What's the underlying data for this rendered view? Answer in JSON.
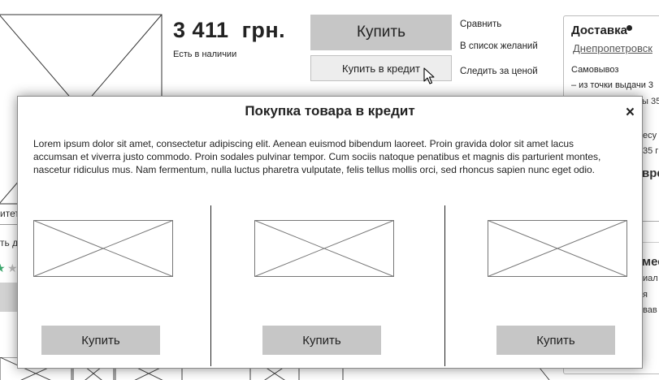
{
  "product": {
    "price": "3 411  грн.",
    "availability": "Есть в наличии",
    "buy_label": "Купить",
    "credit_label": "Купить в кредит",
    "compare_label": "Сравнить",
    "wishlist_label": "В список желаний",
    "price_watch_label": "Следить за ценой"
  },
  "delivery": {
    "title": "Доставка",
    "city": "Днепропетровск",
    "pickup": "Самовывоз",
    "pickup_from": "– из точки выдачи 3",
    "fragments": [
      "ы 35",
      "есу",
      "35 г",
      "вре",
      "мес",
      "иал",
      "я",
      "вав"
    ]
  },
  "left_fragments": [
    "итет",
    "ть д"
  ],
  "modal": {
    "title": "Покупка товара в кредит",
    "close_glyph": "×",
    "description": "Lorem ipsum dolor sit amet, consectetur adipiscing elit. Aenean euismod bibendum laoreet. Proin gravida dolor sit amet lacus accumsan et viverra justo commodo. Proin sodales pulvinar tempor. Cum sociis natoque penatibus et magnis dis parturient montes, nascetur ridiculus mus. Nam fermentum, nulla luctus pharetra vulputate, felis tellus mollis orci, sed rhoncus sapien nunc eget odio.",
    "offers": [
      {
        "button_label": "Купить"
      },
      {
        "button_label": "Купить"
      },
      {
        "button_label": "Купить"
      }
    ]
  },
  "icons": {
    "close": "close-icon",
    "cursor": "mouse-pointer-icon",
    "info": "info-icon",
    "image_placeholder": "image-placeholder-icon",
    "star": "star-icon"
  }
}
